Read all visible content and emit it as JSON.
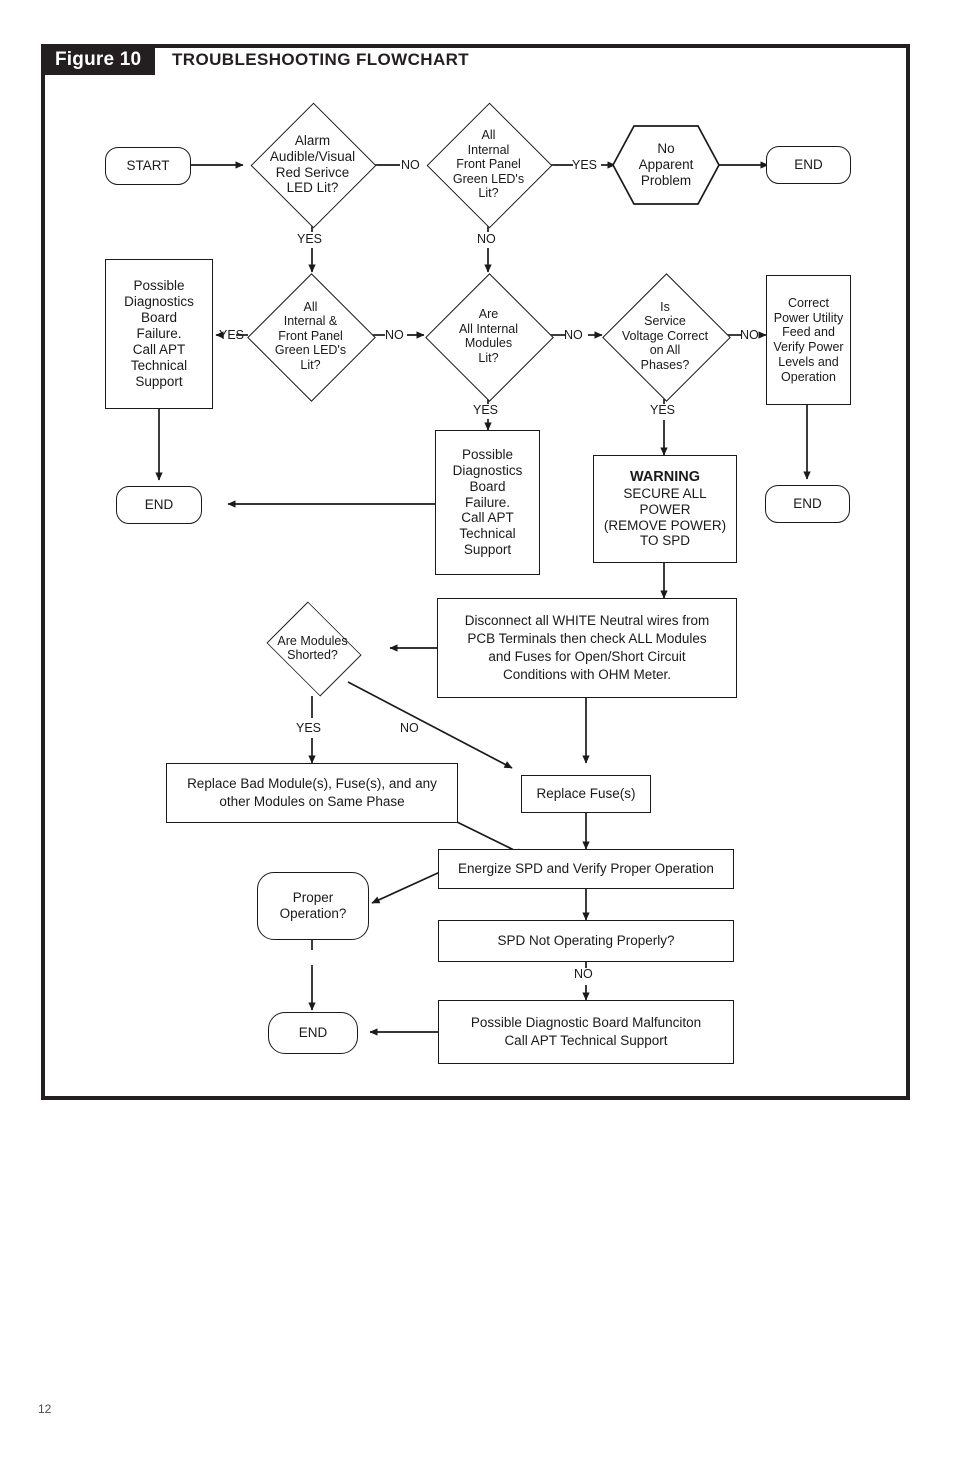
{
  "figure": {
    "badge": "Figure 10",
    "title": "TROUBLESHOOTING FLOWCHART"
  },
  "page": {
    "number": "12"
  },
  "colors": {
    "banner_bg": "#231f20",
    "banner_text": "#ffffff",
    "frame_border": "#231f20",
    "node_stroke": "#1a1a1a",
    "node_fill": "#ffffff"
  },
  "chart_data": {
    "type": "diagram",
    "title": "TROUBLESHOOTING FLOWCHART",
    "subtype": "flowchart",
    "nodes": [
      {
        "id": "start",
        "shape": "rounded",
        "text": "START"
      },
      {
        "id": "alarm_lit",
        "shape": "diamond",
        "text": "Alarm\nAudible/Visual\nRed Serivce\nLED Lit?"
      },
      {
        "id": "all_front_leds",
        "shape": "diamond",
        "text": "All\nInternal\nFront Panel\nGreen LED's\nLit?"
      },
      {
        "id": "no_problem",
        "shape": "hexagon",
        "text": "No\nApparent\nProblem"
      },
      {
        "id": "end_top",
        "shape": "rounded",
        "text": "END"
      },
      {
        "id": "diag_fail_left",
        "shape": "rect",
        "text": "Possible\nDiagnostics\nBoard\nFailure.\nCall APT\nTechnical\nSupport"
      },
      {
        "id": "all_int_front",
        "shape": "diamond",
        "text": "All\nInternal &\nFront Panel\nGreen LED's\nLit?"
      },
      {
        "id": "all_modules",
        "shape": "diamond",
        "text": "Are\nAll Internal\nModules\nLit?"
      },
      {
        "id": "service_volt",
        "shape": "diamond",
        "text": "Is\nService\nVoltage Correct\non All\nPhases?"
      },
      {
        "id": "correct_power",
        "shape": "rect",
        "text": "Correct\nPower Utility\nFeed and\nVerify Power\nLevels and\nOperation"
      },
      {
        "id": "end_left",
        "shape": "rounded",
        "text": "END"
      },
      {
        "id": "diag_fail_mid",
        "shape": "rect",
        "text": "Possible\nDiagnostics\nBoard\nFailure.\nCall  APT\nTechnical\nSupport"
      },
      {
        "id": "warning",
        "shape": "rect",
        "text": "WARNING\nSECURE ALL\nPOWER\n(REMOVE POWER)\nTO SPD"
      },
      {
        "id": "end_right",
        "shape": "rounded",
        "text": "END"
      },
      {
        "id": "disconnect",
        "shape": "rect",
        "text": "Disconnect all WHITE Neutral wires from\nPCB Terminals then check ALL Modules\nand Fuses for Open/Short Circuit\nConditions with OHM Meter."
      },
      {
        "id": "modules_short",
        "shape": "diamond",
        "text": "Are Modules\nShorted?"
      },
      {
        "id": "replace_mod",
        "shape": "rect",
        "text": "Replace Bad Module(s), Fuse(s), and any\nother Modules on Same Phase"
      },
      {
        "id": "replace_fuse",
        "shape": "rect",
        "text": "Replace Fuse(s)"
      },
      {
        "id": "energize",
        "shape": "rect",
        "text": "Energize SPD and Verify Proper Operation"
      },
      {
        "id": "proper_op",
        "shape": "rounded",
        "text": "Proper\nOperation?"
      },
      {
        "id": "spd_not_ok",
        "shape": "rect",
        "text": "SPD Not Operating Properly?"
      },
      {
        "id": "malfunction",
        "shape": "rect",
        "text": "Possible Diagnostic Board Malfunciton\nCall APT Technical Support"
      },
      {
        "id": "end_bottom",
        "shape": "rounded",
        "text": "END"
      }
    ],
    "edges": [
      {
        "from": "start",
        "to": "alarm_lit",
        "label": ""
      },
      {
        "from": "alarm_lit",
        "to": "all_front_leds",
        "label": "NO"
      },
      {
        "from": "alarm_lit",
        "to": "all_int_front",
        "label": "YES"
      },
      {
        "from": "all_front_leds",
        "to": "no_problem",
        "label": "YES"
      },
      {
        "from": "all_front_leds",
        "to": "all_modules",
        "label": "NO"
      },
      {
        "from": "no_problem",
        "to": "end_top",
        "label": ""
      },
      {
        "from": "all_int_front",
        "to": "diag_fail_left",
        "label": "YES"
      },
      {
        "from": "all_int_front",
        "to": "all_modules",
        "label": "NO"
      },
      {
        "from": "diag_fail_left",
        "to": "end_left",
        "label": ""
      },
      {
        "from": "all_modules",
        "to": "diag_fail_mid",
        "label": "YES"
      },
      {
        "from": "all_modules",
        "to": "service_volt",
        "label": "NO"
      },
      {
        "from": "service_volt",
        "to": "correct_power",
        "label": "NO"
      },
      {
        "from": "service_volt",
        "to": "warning",
        "label": "YES"
      },
      {
        "from": "correct_power",
        "to": "end_right",
        "label": ""
      },
      {
        "from": "diag_fail_mid",
        "to": "end_left",
        "label": ""
      },
      {
        "from": "warning",
        "to": "disconnect",
        "label": ""
      },
      {
        "from": "disconnect",
        "to": "modules_short",
        "label": ""
      },
      {
        "from": "disconnect",
        "to": "replace_fuse",
        "label": ""
      },
      {
        "from": "modules_short",
        "to": "replace_mod",
        "label": "YES"
      },
      {
        "from": "modules_short",
        "to": "replace_fuse",
        "label": "NO"
      },
      {
        "from": "replace_mod",
        "to": "energize",
        "label": ""
      },
      {
        "from": "replace_fuse",
        "to": "energize",
        "label": ""
      },
      {
        "from": "energize",
        "to": "proper_op",
        "label": ""
      },
      {
        "from": "energize",
        "to": "spd_not_ok",
        "label": ""
      },
      {
        "from": "spd_not_ok",
        "to": "malfunction",
        "label": "NO"
      },
      {
        "from": "proper_op",
        "to": "end_bottom",
        "label": ""
      },
      {
        "from": "malfunction",
        "to": "end_bottom",
        "label": ""
      }
    ]
  },
  "nodes": {
    "start": "START",
    "alarm_lit": {
      "l1": "Alarm",
      "l2": "Audible/Visual",
      "l3": "Red Serivce",
      "l4": "LED Lit?"
    },
    "all_front_leds": {
      "l1": "All",
      "l2": "Internal",
      "l3": "Front Panel",
      "l4": "Green LED's",
      "l5": "Lit?"
    },
    "no_problem": {
      "l1": "No",
      "l2": "Apparent",
      "l3": "Problem"
    },
    "end_top": "END",
    "diag_fail_left": {
      "l1": "Possible",
      "l2": "Diagnostics",
      "l3": "Board",
      "l4": "Failure.",
      "l5": "Call APT",
      "l6": "Technical",
      "l7": "Support"
    },
    "all_int_front": {
      "l1": "All",
      "l2": "Internal &",
      "l3": "Front Panel",
      "l4": "Green LED's",
      "l5": "Lit?"
    },
    "all_modules": {
      "l1": "Are",
      "l2": "All Internal",
      "l3": "Modules",
      "l4": "Lit?"
    },
    "service_volt": {
      "l1": "Is",
      "l2": "Service",
      "l3": "Voltage Correct",
      "l4": "on All",
      "l5": "Phases?"
    },
    "correct_power": {
      "l1": "Correct",
      "l2": "Power Utility",
      "l3": "Feed and",
      "l4": "Verify Power",
      "l5": "Levels and",
      "l6": "Operation"
    },
    "end_left": "END",
    "diag_fail_mid": {
      "l1": "Possible",
      "l2": "Diagnostics",
      "l3": "Board",
      "l4": "Failure.",
      "l5": "Call  APT",
      "l6": "Technical",
      "l7": "Support"
    },
    "warning": {
      "l1": "WARNING",
      "l2": "SECURE ALL",
      "l3": "POWER",
      "l4": "(REMOVE POWER)",
      "l5": "TO SPD"
    },
    "end_right": "END",
    "disconnect": {
      "l1": "Disconnect all WHITE Neutral wires from",
      "l2": "PCB Terminals then check ALL Modules",
      "l3": "and Fuses for Open/Short Circuit",
      "l4": "Conditions with OHM Meter."
    },
    "modules_short": {
      "l1": "Are Modules",
      "l2": "Shorted?"
    },
    "replace_mod": {
      "l1": "Replace Bad Module(s), Fuse(s), and any",
      "l2": "other Modules on Same Phase"
    },
    "replace_fuse": "Replace Fuse(s)",
    "energize": "Energize SPD and Verify Proper Operation",
    "proper_op": {
      "l1": "Proper",
      "l2": "Operation?"
    },
    "spd_not_ok": "SPD Not Operating Properly?",
    "malfunction": {
      "l1": "Possible Diagnostic Board Malfunciton",
      "l2": "Call APT Technical Support"
    },
    "end_bottom": "END"
  },
  "edge_labels": {
    "alarm_no": "NO",
    "alarm_yes": "YES",
    "frontled_yes": "YES",
    "frontled_no": "NO",
    "intfront_yes": "YES",
    "intfront_no": "NO",
    "modules_yes": "YES",
    "modules_no": "NO",
    "volt_no": "NO",
    "volt_yes": "YES",
    "short_yes": "YES",
    "short_no": "NO",
    "spd_no": "NO"
  }
}
